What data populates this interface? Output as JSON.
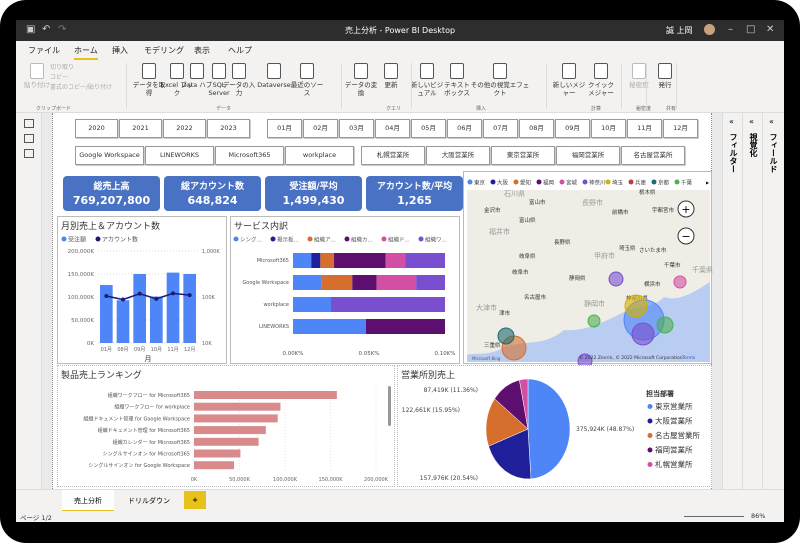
{
  "window": {
    "title": "売上分析 - Power BI Desktop",
    "user": "誠 上岡"
  },
  "menu": [
    "ファイル",
    "ホーム",
    "挿入",
    "モデリング",
    "表示",
    "ヘルプ"
  ],
  "ribbon": {
    "buttons": [
      {
        "label": "貼り付け",
        "disabled": true
      },
      {
        "label": "データを取得"
      },
      {
        "label": "Excel ブック"
      },
      {
        "label": "Data ハブ"
      },
      {
        "label": "SQL Server"
      },
      {
        "label": "データの入力"
      },
      {
        "label": "Dataverse"
      },
      {
        "label": "最近のソース"
      },
      {
        "label": "データの変換"
      },
      {
        "label": "更新"
      },
      {
        "label": "新しいビジュアル"
      },
      {
        "label": "テキスト ボックス"
      },
      {
        "label": "その他の視覚エフェクト"
      },
      {
        "label": "新しいメジャー"
      },
      {
        "label": "クイック メジャー"
      },
      {
        "label": "秘密度",
        "disabled": true
      },
      {
        "label": "発行"
      }
    ],
    "clipboard_small": [
      "切り取り",
      "コピー",
      "書式のコピー/貼り付け"
    ],
    "groups": [
      "クリップボード",
      "データ",
      "クエリ",
      "挿入",
      "計算",
      "秘密度",
      "共有"
    ]
  },
  "panes": {
    "filters": "フィルター",
    "visualizations": "視覚化",
    "fields": "フィールド"
  },
  "slicers": {
    "years": [
      "2020",
      "2021",
      "2022",
      "2023"
    ],
    "months": [
      "01月",
      "02月",
      "03月",
      "04月",
      "05月",
      "06月",
      "07月",
      "08月",
      "09月",
      "10月",
      "11月",
      "12月"
    ],
    "products": [
      "Google Workspace",
      "LINEWORKS",
      "Microsoft365",
      "workplace"
    ],
    "offices": [
      "札幌営業所",
      "大阪営業所",
      "東京営業所",
      "福岡営業所",
      "名古屋営業所"
    ]
  },
  "kpis": [
    {
      "label": "総売上高",
      "value": "769,207,800"
    },
    {
      "label": "総アカウント数",
      "value": "648,824"
    },
    {
      "label": "受注額/平均",
      "value": "1,499,430"
    },
    {
      "label": "アカウント数/平均",
      "value": "1,265"
    }
  ],
  "map": {
    "legend": [
      "東京",
      "大阪",
      "愛知",
      "福岡",
      "宮城",
      "神奈川",
      "埼玉",
      "兵庫",
      "京都",
      "千葉"
    ],
    "legend_colors": [
      "#4e86f7",
      "#1f1f9a",
      "#d66f2d",
      "#5c0f6e",
      "#d34fa4",
      "#7a4fcf",
      "#d4b000",
      "#c8383c",
      "#1d6a70",
      "#4caf50"
    ],
    "places": [
      "石川県",
      "富山市",
      "金沢市",
      "富山県",
      "長野市",
      "栃木県",
      "宇都宮市",
      "前橋市",
      "福井市",
      "長野県",
      "埼玉県",
      "さいたま市",
      "甲府市",
      "岐阜県",
      "岐阜市",
      "千葉市",
      "千葉県",
      "静岡県",
      "横浜市",
      "名古屋市",
      "静岡市",
      "神奈川県",
      "三重県",
      "津市",
      "大津市"
    ],
    "copyright": "© 2022 Zenrin, © 2022 Microsoft Corporation",
    "terms": "Terms",
    "bing": "Microsoft Bing"
  },
  "chart_data": [
    {
      "type": "bar",
      "title": "月別売上＆アカウント数",
      "legend": [
        "受注額",
        "アカウント数"
      ],
      "xlabel": "月",
      "categories": [
        "01月",
        "08月",
        "09月",
        "10月",
        "11月",
        "12月"
      ],
      "series": [
        {
          "name": "受注額",
          "kind": "bar",
          "values": [
            126000,
            93000,
            150000,
            101000,
            153000,
            150000
          ],
          "color": "#4e86f7"
        },
        {
          "name": "アカウント数",
          "kind": "line",
          "axis": "right",
          "values": [
            105,
            88,
            118,
            91,
            120,
            110
          ],
          "color": "#1a1a7a"
        }
      ],
      "ylim": [
        0,
        200000
      ],
      "yticks": [
        "0K",
        "50,000K",
        "100,000K",
        "150,000K",
        "200,000K"
      ],
      "y2ticks": [
        "10K",
        "100K",
        "1,000K"
      ]
    },
    {
      "type": "bar",
      "stacked": true,
      "title": "サービス内訳",
      "legend": [
        "シング...",
        "掲示板...",
        "組織ア...",
        "組織カ...",
        "組織ド...",
        "組織ワ..."
      ],
      "colors": [
        "#4e86f7",
        "#1f1f9a",
        "#d66f2d",
        "#5c0f6e",
        "#d34fa4",
        "#7a4fcf"
      ],
      "categories": [
        "Microsoft365",
        "Google Workspace",
        "workplace",
        "LINEWORKS"
      ],
      "series": [
        [
          12,
          6,
          9,
          34,
          13,
          26
        ],
        [
          19,
          0,
          20,
          16,
          26,
          19
        ],
        [
          25,
          0,
          0,
          0,
          0,
          75
        ],
        [
          48,
          0,
          0,
          52,
          0,
          0
        ]
      ],
      "xticks": [
        "0.00K%",
        "0.05K%",
        "0.10K%"
      ]
    },
    {
      "type": "bar",
      "title": "製品売上ランキング",
      "categories": [
        "組織ワークフロー for Microsoft365",
        "組織ワークフロー for workplace",
        "組織ドキュメント管理 for Google Workspace",
        "組織ドキュメント管理 for Microsoft365",
        "組織カレンダー for Microsoft365",
        "シングルサインオン for Microsoft365",
        "シングルサインオン for Google Workspace"
      ],
      "values": [
        157000,
        95000,
        92000,
        79000,
        71000,
        51000,
        44000
      ],
      "color": "#d98b8b",
      "xlim": [
        0,
        200000
      ],
      "xticks": [
        "0K",
        "50,000K",
        "100,000K",
        "150,000K",
        "200,000K"
      ]
    },
    {
      "type": "pie",
      "title": "営業所別売上",
      "legend_title": "担当部署",
      "labels": [
        "東京営業所",
        "大阪営業所",
        "名古屋営業所",
        "福岡営業所",
        "札幌営業所"
      ],
      "values": [
        48.87,
        20.54,
        15.95,
        11.36,
        3.28
      ],
      "data_labels": [
        "375,924K (48.87%)",
        "157,976K (20.54%)",
        "122,661K (15.95%)",
        "87,419K (11.36%)",
        ""
      ],
      "colors": [
        "#4e86f7",
        "#1f1f9a",
        "#d66f2d",
        "#5c0f6e",
        "#d34fa4"
      ]
    }
  ],
  "page_tabs": [
    "売上分析",
    "ドリルダウン"
  ],
  "add_tab": "+",
  "status": {
    "page": "ページ 1/2",
    "zoom": "86%"
  }
}
